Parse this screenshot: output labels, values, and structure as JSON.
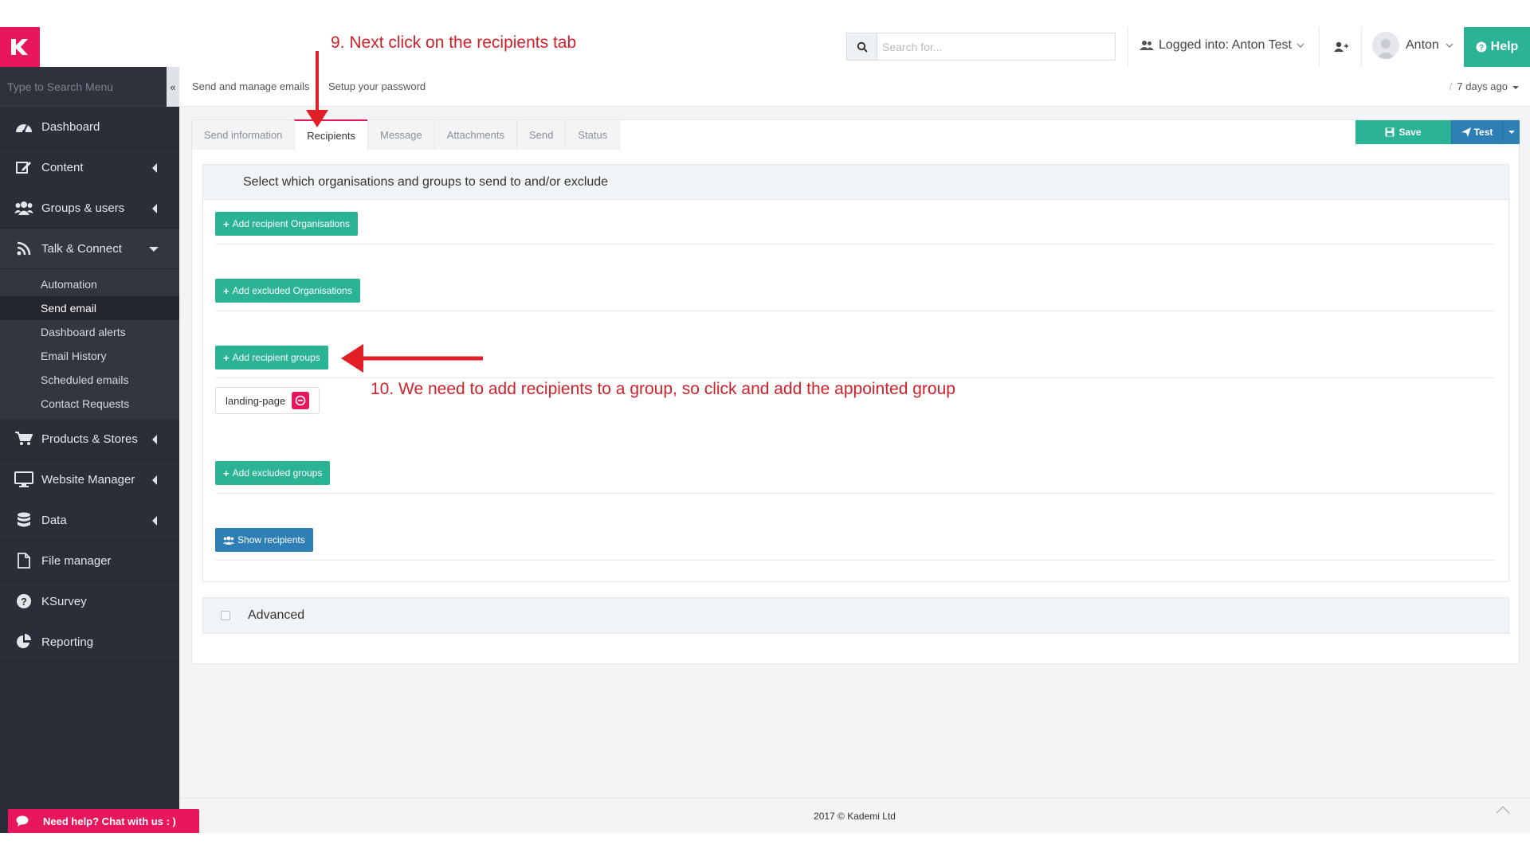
{
  "header": {
    "search_placeholder": "Search for...",
    "logged_label": "Logged into: Anton Test",
    "user_name": "Anton",
    "help_label": "Help"
  },
  "sidebar": {
    "search_placeholder": "Type to Search Menu",
    "collapse_glyph": "«",
    "items": [
      {
        "label": "Dashboard",
        "icon": "dashboard-icon"
      },
      {
        "label": "Content",
        "icon": "edit-icon"
      },
      {
        "label": "Groups & users",
        "icon": "users-icon"
      },
      {
        "label": "Talk & Connect",
        "icon": "rss-icon"
      },
      {
        "label": "Products & Stores",
        "icon": "cart-icon"
      },
      {
        "label": "Website Manager",
        "icon": "monitor-icon"
      },
      {
        "label": "Data",
        "icon": "database-icon"
      },
      {
        "label": "File manager",
        "icon": "file-icon"
      },
      {
        "label": "KSurvey",
        "icon": "question-icon"
      },
      {
        "label": "Reporting",
        "icon": "pie-chart-icon"
      }
    ],
    "sub_items": [
      "Automation",
      "Send email",
      "Dashboard alerts",
      "Email History",
      "Scheduled emails",
      "Contact Requests"
    ]
  },
  "breadcrumb": {
    "item1": "Send and manage emails",
    "item2": "Setup your password",
    "slash": "/",
    "time": "7 days ago"
  },
  "tabs": [
    "Send information",
    "Recipients",
    "Message",
    "Attachments",
    "Send",
    "Status"
  ],
  "actions": {
    "save": "Save",
    "test": "Test"
  },
  "recipients": {
    "heading": "Select which organisations and groups to send to and/or exclude",
    "add_recipient_orgs": "Add recipient Organisations",
    "add_excluded_orgs": "Add excluded Organisations",
    "add_recipient_groups": "Add recipient groups",
    "group_tag": "landing-page",
    "add_excluded_groups": "Add excluded groups",
    "show_recipients": "Show recipients"
  },
  "advanced_label": "Advanced",
  "footer": {
    "copyright": "2017 © Kademi Ltd",
    "chat": "Need help? Chat with us : )"
  },
  "annotations": {
    "step9": "9. Next click on the recipients tab",
    "step10": "10. We need to add recipients to a group, so click and add the appointed group"
  },
  "colors": {
    "brand_pink": "#e8175d",
    "green": "#2ab394",
    "blue": "#2f7fb7",
    "sidebar": "#2b2e38",
    "annotation_red": "#d0202a"
  }
}
